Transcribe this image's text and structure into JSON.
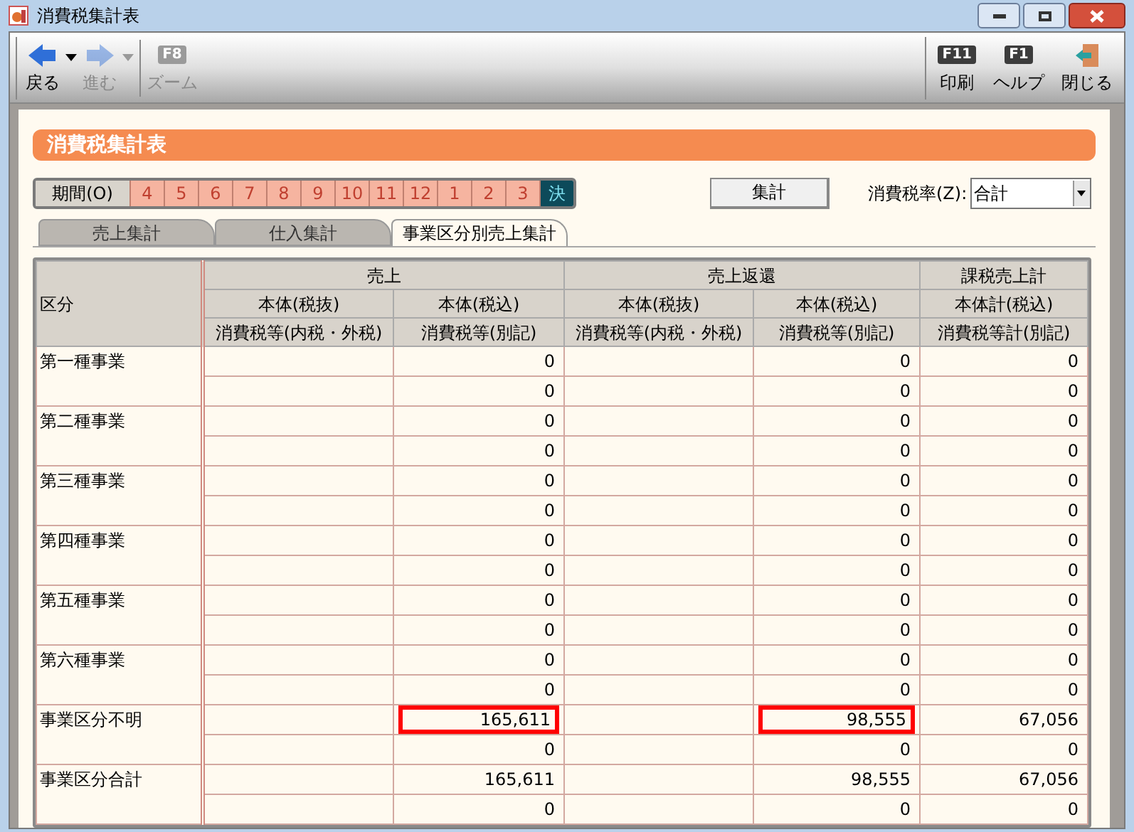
{
  "window": {
    "title": "消費税集計表"
  },
  "toolbar": {
    "left": [
      {
        "kind": "back",
        "label": "戻る",
        "disabled": false
      },
      {
        "kind": "forward",
        "label": "進む",
        "disabled": true
      },
      {
        "kind": "key",
        "key": "F8",
        "label": "ズーム",
        "disabled": true
      }
    ],
    "right": [
      {
        "kind": "key",
        "key": "F11",
        "label": "印刷",
        "disabled": false
      },
      {
        "kind": "key",
        "key": "F1",
        "label": "ヘルプ",
        "disabled": false
      },
      {
        "kind": "exit",
        "label": "閉じる",
        "disabled": false
      }
    ]
  },
  "header": {
    "title": "消費税集計表"
  },
  "period": {
    "label": "期間(O)",
    "items": [
      {
        "label": "4",
        "selected": false
      },
      {
        "label": "5",
        "selected": false
      },
      {
        "label": "6",
        "selected": false
      },
      {
        "label": "7",
        "selected": false
      },
      {
        "label": "8",
        "selected": false
      },
      {
        "label": "9",
        "selected": false
      },
      {
        "label": "10",
        "selected": false
      },
      {
        "label": "11",
        "selected": false
      },
      {
        "label": "12",
        "selected": false
      },
      {
        "label": "1",
        "selected": false
      },
      {
        "label": "2",
        "selected": false
      },
      {
        "label": "3",
        "selected": false
      },
      {
        "label": "決",
        "selected": true
      }
    ]
  },
  "aggregate_button": "集計",
  "tax_rate": {
    "label": "消費税率(Z):",
    "value": "合計"
  },
  "tabs": [
    {
      "label": "売上集計",
      "selected": false
    },
    {
      "label": "仕入集計",
      "selected": false
    },
    {
      "label": "事業区分別売上集計",
      "selected": true
    }
  ],
  "table": {
    "row_header": "区分",
    "groups": [
      {
        "label": "売上",
        "columns": [
          {
            "line1": "本体(税抜)",
            "line2": "消費税等(内税・外税)"
          },
          {
            "line1": "本体(税込)",
            "line2": "消費税等(別記)"
          }
        ]
      },
      {
        "label": "売上返還",
        "columns": [
          {
            "line1": "本体(税抜)",
            "line2": "消費税等(内税・外税)"
          },
          {
            "line1": "本体(税込)",
            "line2": "消費税等(別記)"
          }
        ]
      },
      {
        "label": "課税売上計",
        "columns": [
          {
            "line1": "本体計(税込)",
            "line2": "消費税等計(別記)"
          }
        ]
      }
    ],
    "rows": [
      {
        "label": "第一種事業",
        "lines": [
          [
            {
              "value": "0",
              "highlighted": false
            },
            {
              "value": "0",
              "highlighted": false
            },
            {
              "value": "0",
              "highlighted": false
            }
          ],
          [
            {
              "value": "0",
              "highlighted": false
            },
            {
              "value": "0",
              "highlighted": false
            },
            {
              "value": "0",
              "highlighted": false
            }
          ]
        ]
      },
      {
        "label": "第二種事業",
        "lines": [
          [
            {
              "value": "0",
              "highlighted": false
            },
            {
              "value": "0",
              "highlighted": false
            },
            {
              "value": "0",
              "highlighted": false
            }
          ],
          [
            {
              "value": "0",
              "highlighted": false
            },
            {
              "value": "0",
              "highlighted": false
            },
            {
              "value": "0",
              "highlighted": false
            }
          ]
        ]
      },
      {
        "label": "第三種事業",
        "lines": [
          [
            {
              "value": "0",
              "highlighted": false
            },
            {
              "value": "0",
              "highlighted": false
            },
            {
              "value": "0",
              "highlighted": false
            }
          ],
          [
            {
              "value": "0",
              "highlighted": false
            },
            {
              "value": "0",
              "highlighted": false
            },
            {
              "value": "0",
              "highlighted": false
            }
          ]
        ]
      },
      {
        "label": "第四種事業",
        "lines": [
          [
            {
              "value": "0",
              "highlighted": false
            },
            {
              "value": "0",
              "highlighted": false
            },
            {
              "value": "0",
              "highlighted": false
            }
          ],
          [
            {
              "value": "0",
              "highlighted": false
            },
            {
              "value": "0",
              "highlighted": false
            },
            {
              "value": "0",
              "highlighted": false
            }
          ]
        ]
      },
      {
        "label": "第五種事業",
        "lines": [
          [
            {
              "value": "0",
              "highlighted": false
            },
            {
              "value": "0",
              "highlighted": false
            },
            {
              "value": "0",
              "highlighted": false
            }
          ],
          [
            {
              "value": "0",
              "highlighted": false
            },
            {
              "value": "0",
              "highlighted": false
            },
            {
              "value": "0",
              "highlighted": false
            }
          ]
        ]
      },
      {
        "label": "第六種事業",
        "lines": [
          [
            {
              "value": "0",
              "highlighted": false
            },
            {
              "value": "0",
              "highlighted": false
            },
            {
              "value": "0",
              "highlighted": false
            }
          ],
          [
            {
              "value": "0",
              "highlighted": false
            },
            {
              "value": "0",
              "highlighted": false
            },
            {
              "value": "0",
              "highlighted": false
            }
          ]
        ]
      },
      {
        "label": "事業区分不明",
        "lines": [
          [
            {
              "value": "165,611",
              "highlighted": true
            },
            {
              "value": "98,555",
              "highlighted": true
            },
            {
              "value": "67,056",
              "highlighted": false
            }
          ],
          [
            {
              "value": "0",
              "highlighted": false
            },
            {
              "value": "0",
              "highlighted": false
            },
            {
              "value": "0",
              "highlighted": false
            }
          ]
        ]
      },
      {
        "label": "事業区分合計",
        "lines": [
          [
            {
              "value": "165,611",
              "highlighted": false
            },
            {
              "value": "98,555",
              "highlighted": false
            },
            {
              "value": "67,056",
              "highlighted": false
            }
          ],
          [
            {
              "value": "0",
              "highlighted": false
            },
            {
              "value": "0",
              "highlighted": false
            },
            {
              "value": "0",
              "highlighted": false
            }
          ]
        ]
      }
    ]
  }
}
